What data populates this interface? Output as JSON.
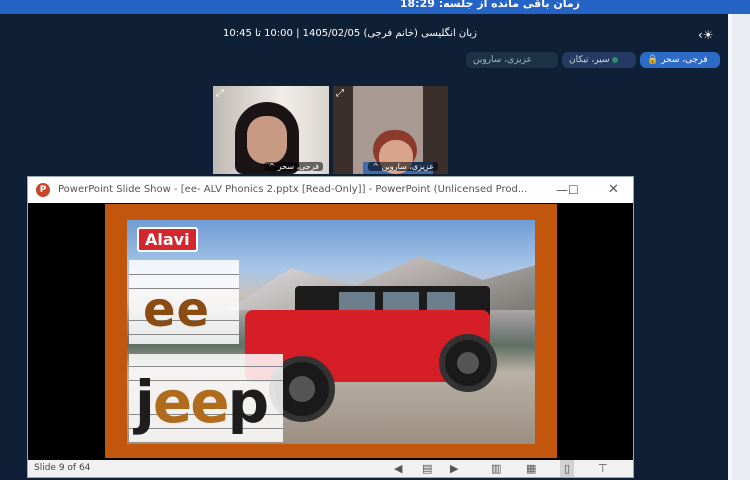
{
  "session": {
    "remaining_text": "زمان باقی مانده از جلسه: 18:29"
  },
  "class_info": {
    "title": "زبان انگلیسی (خانم فرجی) 1405/02/05 | 10:00 تا 10:45"
  },
  "participants": [
    {
      "name": "فرجی، سحر"
    },
    {
      "name": "سیر، تیکان"
    },
    {
      "name": "عزیزی، ساروین"
    }
  ],
  "videos": [
    {
      "label": "^ فرجی، سحر"
    },
    {
      "label": "^ عزیزی، ساروین"
    }
  ],
  "ppt": {
    "title": "PowerPoint Slide Show - [ee- ALV Phonics 2.pptx [Read-Only]] - PowerPoint (Unlicensed Prod...",
    "brand": "Alavi",
    "word_sound": "ee",
    "word_full_prefix": "j",
    "word_full_mid": "ee",
    "word_full_suffix": "p",
    "slide_status": "Slide 9 of 64"
  },
  "icons": {
    "user": "user-icon",
    "lock": "lock-icon",
    "expand": "expand-icon",
    "minimize": "minimize-icon",
    "maximize": "maximize-icon",
    "close": "close-icon",
    "prev": "previous-slide-icon",
    "notes": "notes-icon",
    "next": "next-slide-icon"
  }
}
